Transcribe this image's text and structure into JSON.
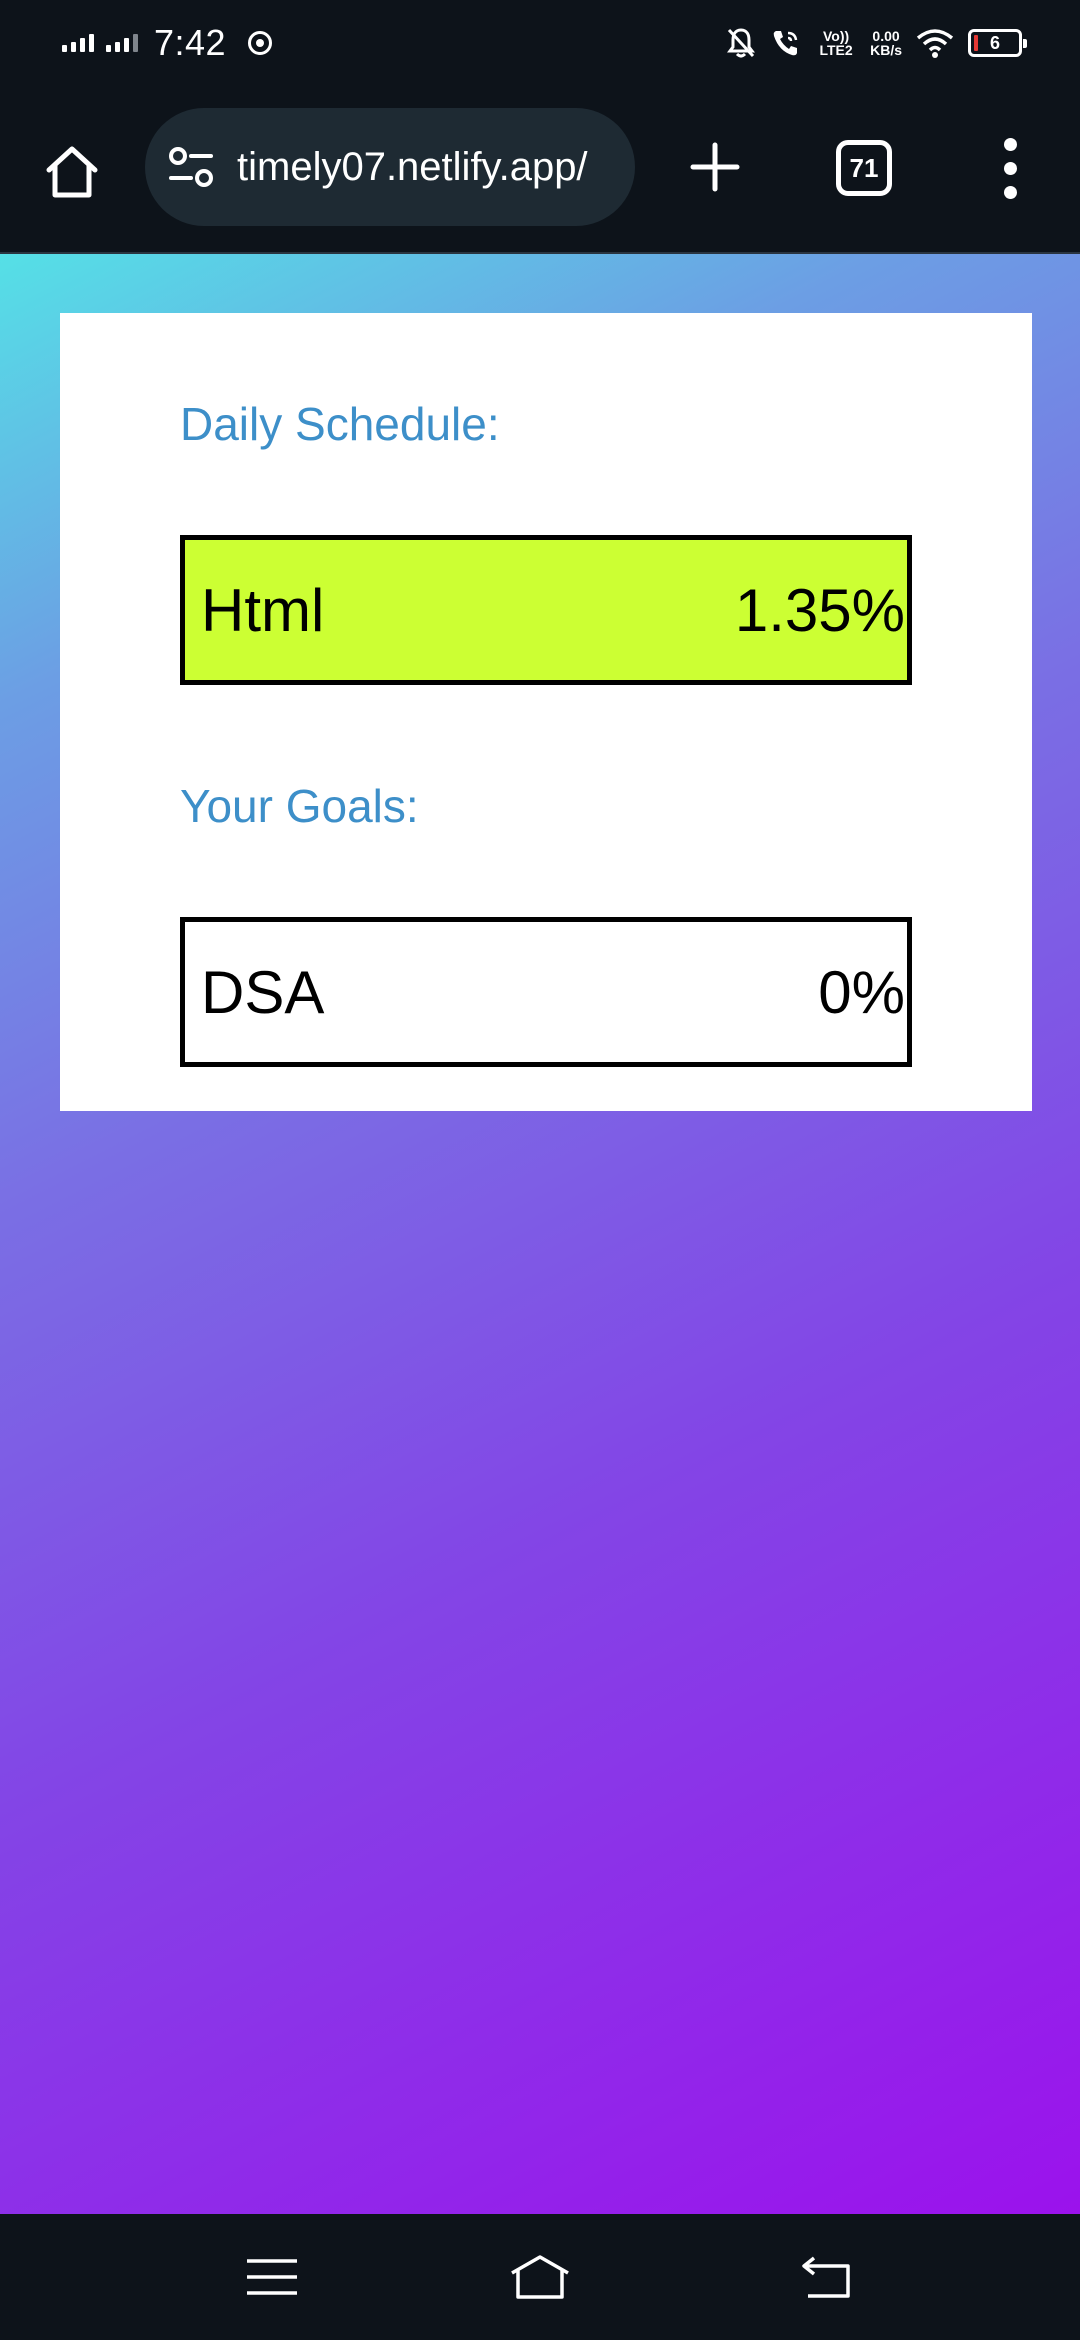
{
  "status_bar": {
    "time": "7:42",
    "volte": "Vo)) LTE2",
    "net_speed_value": "0.00",
    "net_speed_unit": "KB/s",
    "battery_level": "6"
  },
  "browser": {
    "url": "timely07.netlify.app/",
    "tab_count": "71"
  },
  "page": {
    "schedule_heading": "Daily Schedule:",
    "schedule_items": [
      {
        "name": "Html",
        "percent": "1.35%",
        "color": "#ccff33"
      }
    ],
    "goals_heading": "Your Goals:",
    "goal_items": [
      {
        "name": "DSA",
        "percent": "0%",
        "color": "#ffffff"
      }
    ],
    "background_gradient": [
      "#55e0e6",
      "#7a6fe4",
      "#9b12ec"
    ],
    "heading_color": "#3d8fc9"
  },
  "icons": {
    "home": "home-icon",
    "site_settings": "site-settings-icon",
    "new_tab": "plus-icon",
    "more": "more-vertical-icon",
    "nav_menu": "recent-apps-icon",
    "nav_home": "nav-home-icon",
    "nav_back": "back-icon"
  }
}
